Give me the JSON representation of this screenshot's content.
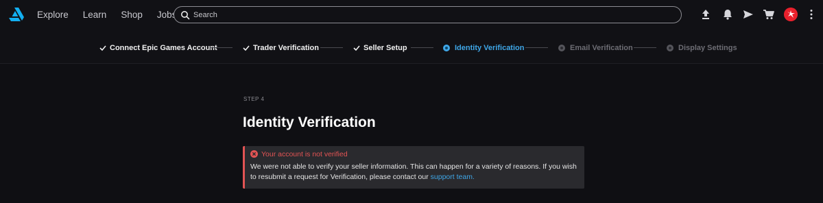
{
  "nav": {
    "links": [
      "Explore",
      "Learn",
      "Shop",
      "Jobs"
    ],
    "search_placeholder": "Search",
    "icons": [
      "upload-icon",
      "bell-icon",
      "send-icon",
      "cart-icon",
      "avatar",
      "more-icon"
    ]
  },
  "steps": [
    {
      "label": "Connect Epic Games Account",
      "state": "done"
    },
    {
      "label": "Trader Verification",
      "state": "done"
    },
    {
      "label": "Seller Setup",
      "state": "done"
    },
    {
      "label": "Identity Verification",
      "state": "active"
    },
    {
      "label": "Email Verification",
      "state": "pending"
    },
    {
      "label": "Display Settings",
      "state": "pending"
    }
  ],
  "main": {
    "step_label": "STEP 4",
    "title": "Identity Verification",
    "alert": {
      "title": "Your account is not verified",
      "body": "We were not able to verify your seller information. This can happen for a variety of reasons. If you wish to resubmit a request for Verification, please contact our",
      "link": "support team."
    }
  },
  "colors": {
    "background": "#0f0f13",
    "accent": "#3fa7e8",
    "error": "#e35454",
    "alert_bg": "#2a2a2e"
  }
}
